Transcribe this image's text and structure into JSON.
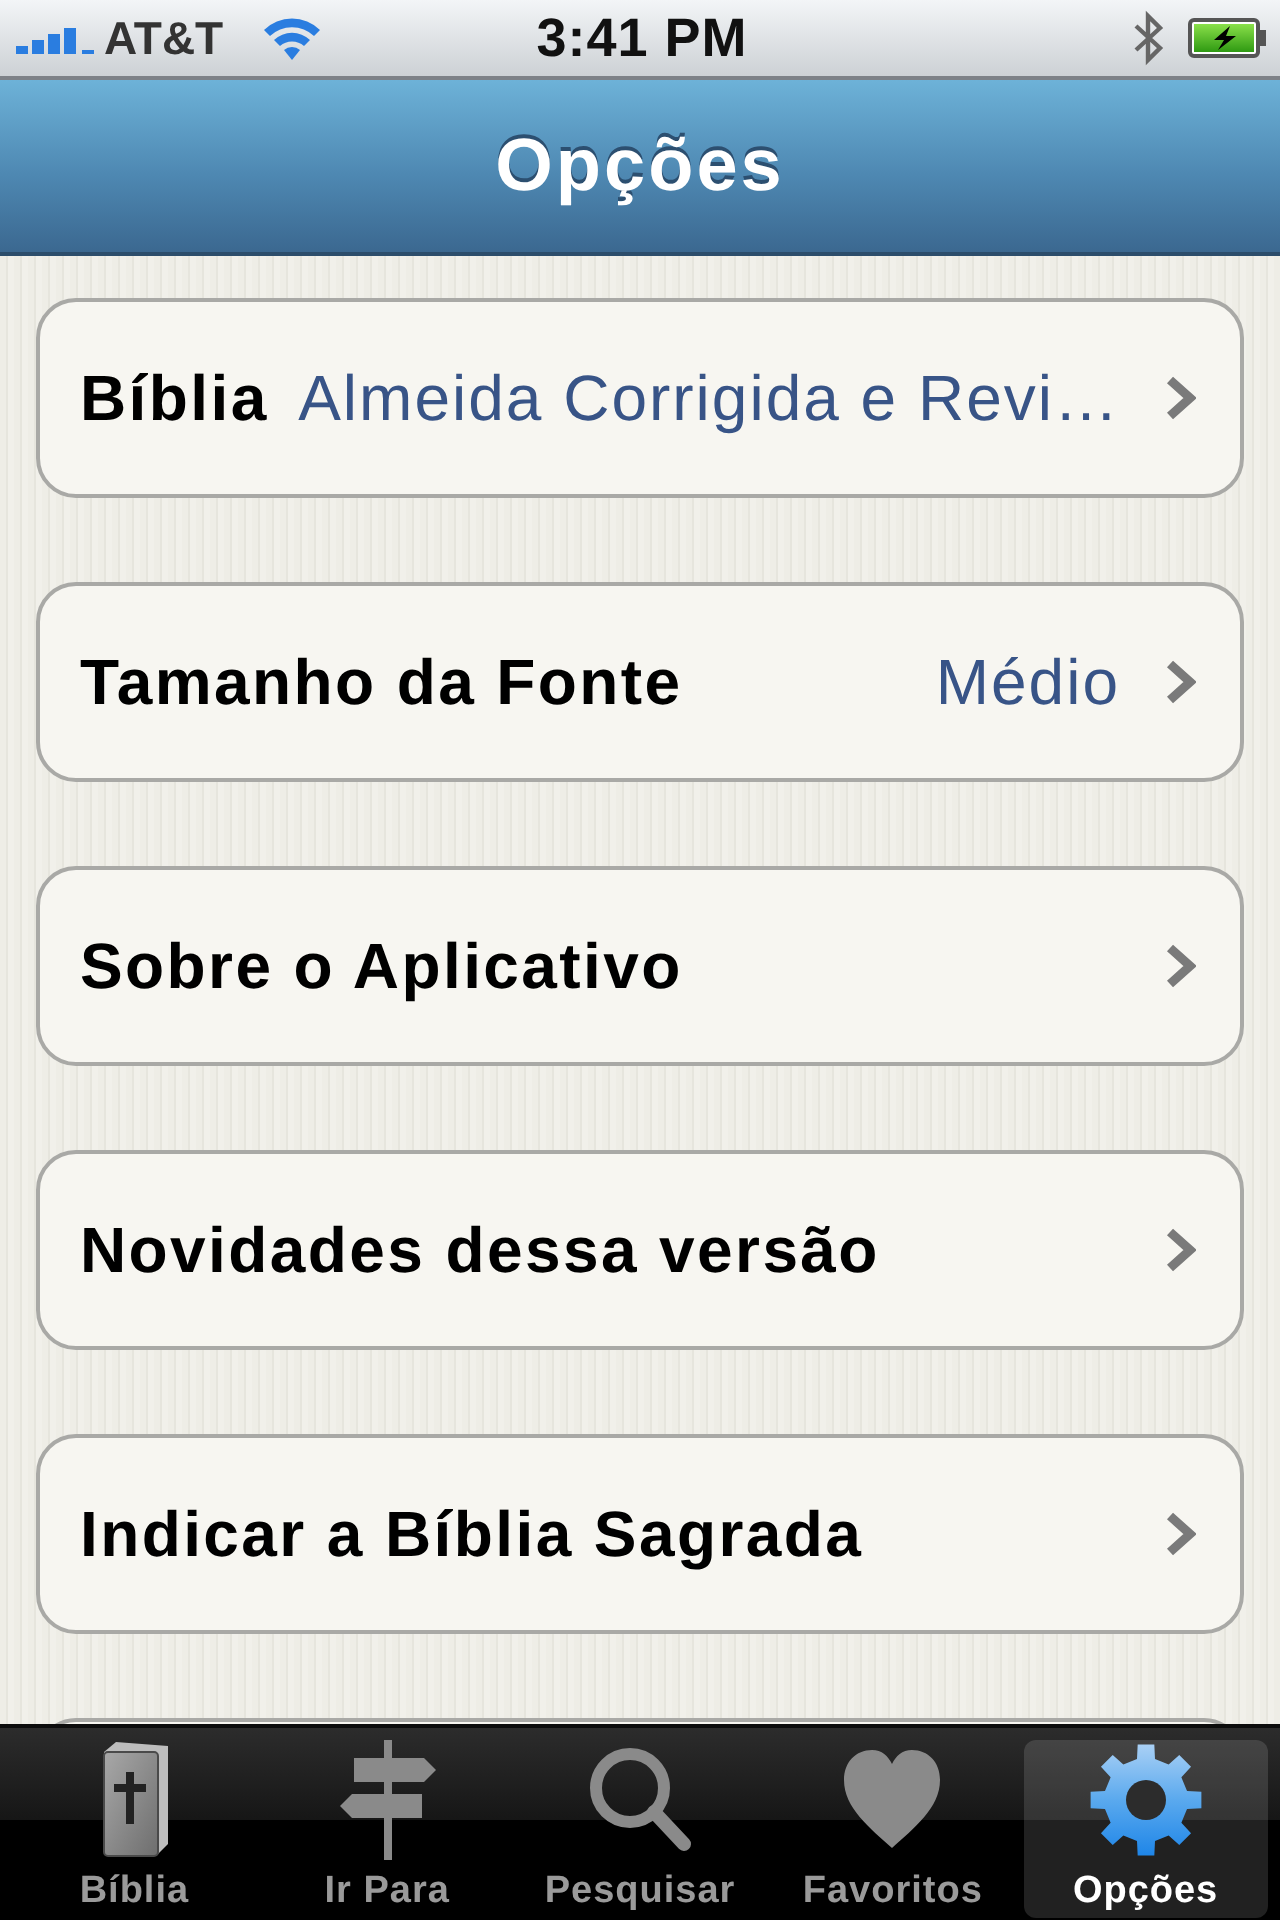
{
  "status_bar": {
    "carrier": "AT&T",
    "time": "3:41 PM"
  },
  "nav_bar": {
    "title": "Opções"
  },
  "settings": {
    "rows": [
      {
        "label": "Bíblia",
        "value": "Almeida Corrigida e Revi…"
      },
      {
        "label": "Tamanho da Fonte",
        "value": "Médio"
      },
      {
        "label": "Sobre o Aplicativo"
      },
      {
        "label": "Novidades dessa versão"
      },
      {
        "label": "Indicar a Bíblia Sagrada"
      }
    ],
    "more_below": true
  },
  "tabs": [
    {
      "label": "Bíblia",
      "selected": false
    },
    {
      "label": "Ir Para",
      "selected": false
    },
    {
      "label": "Pesquisar",
      "selected": false
    },
    {
      "label": "Favoritos",
      "selected": false
    },
    {
      "label": "Opções",
      "selected": true
    }
  ]
}
